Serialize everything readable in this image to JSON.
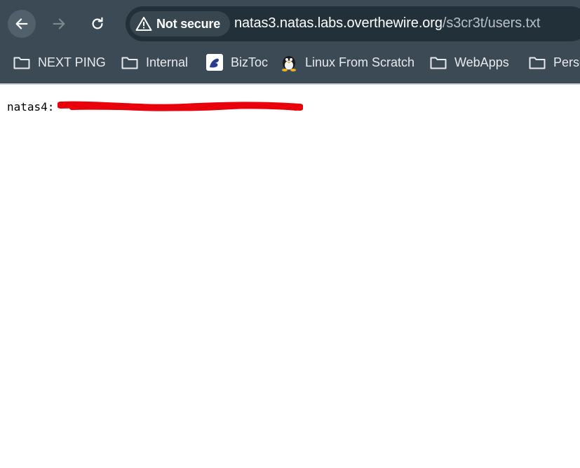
{
  "browser": {
    "security_label": "Not secure",
    "url_host": "natas3.natas.labs.overthewire.org",
    "url_path": "/s3cr3t/users.txt",
    "icons": {
      "back": "arrow-left-icon",
      "forward": "arrow-right-icon",
      "reload": "reload-icon",
      "security": "warning-triangle-icon"
    }
  },
  "bookmarks": [
    {
      "label": "NEXT PING",
      "icon": "folder-icon"
    },
    {
      "label": "Internal",
      "icon": "folder-icon"
    },
    {
      "label": "BizToc",
      "icon": "biztoc-favicon"
    },
    {
      "label": "Linux From Scratch",
      "icon": "tux-favicon"
    },
    {
      "label": "WebApps",
      "icon": "folder-icon"
    },
    {
      "label": "Perso",
      "icon": "folder-icon"
    }
  ],
  "page": {
    "text": "natas4:"
  },
  "colors": {
    "toolbar": "#3c4a55",
    "omnibox": "#22303a",
    "redaction": "#e8000a"
  }
}
